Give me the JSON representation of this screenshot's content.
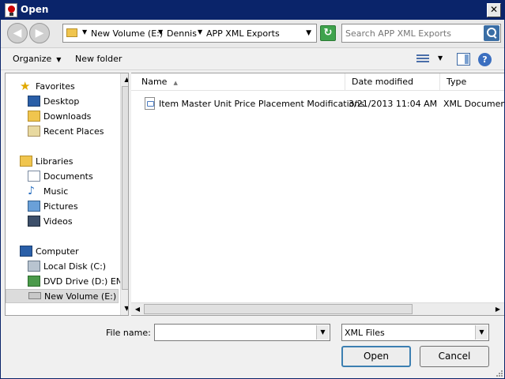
{
  "window": {
    "title": "Open",
    "close_glyph": "✕"
  },
  "nav": {
    "back_icon": "back-arrow-icon",
    "forward_icon": "forward-arrow-icon",
    "breadcrumbs": [
      "New Volume (E:)",
      "Dennis",
      "APP XML Exports"
    ],
    "search_placeholder": "Search APP XML Exports"
  },
  "toolbar": {
    "organize_label": "Organize",
    "new_folder_label": "New folder",
    "help_glyph": "?"
  },
  "sidebar": {
    "favorites": {
      "label": "Favorites",
      "items": [
        "Desktop",
        "Downloads",
        "Recent Places"
      ]
    },
    "libraries": {
      "label": "Libraries",
      "items": [
        "Documents",
        "Music",
        "Pictures",
        "Videos"
      ]
    },
    "computer": {
      "label": "Computer",
      "items": [
        "Local Disk (C:)",
        "DVD Drive (D:) ENU",
        "New Volume (E:)"
      ]
    },
    "selected": "New Volume (E:)"
  },
  "file_list": {
    "columns": [
      "Name",
      "Date modified",
      "Type"
    ],
    "sorted_by": "Name",
    "rows": [
      {
        "name": "Item Master Unit Price Placement Modifications",
        "date_modified": "3/21/2013 11:04 AM",
        "type": "XML Document"
      }
    ]
  },
  "footer": {
    "file_name_label": "File name:",
    "file_name_value": "",
    "file_type_value": "XML Files",
    "open_label": "Open",
    "cancel_label": "Cancel"
  },
  "colors": {
    "titlebar": "#0a246a",
    "accent": "#3c7fb1",
    "selection": "#dcdcdc"
  }
}
